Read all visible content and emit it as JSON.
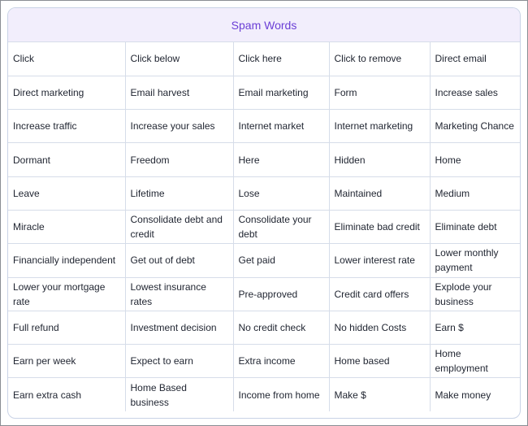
{
  "title": "Spam Words",
  "rows": [
    [
      "Click",
      "Click below",
      "Click here",
      "Click to remove",
      "Direct email"
    ],
    [
      "Direct marketing",
      "Email harvest",
      "Email marketing",
      "Form",
      "Increase sales"
    ],
    [
      "Increase traffic",
      "Increase your sales",
      "Internet market",
      "Internet marketing",
      "Marketing Chance"
    ],
    [
      "Dormant",
      "Freedom",
      "Here",
      "Hidden",
      "Home"
    ],
    [
      "Leave",
      "Lifetime",
      "Lose",
      "Maintained",
      "Medium"
    ],
    [
      "Miracle",
      "Consolidate debt and credit",
      "Consolidate your debt",
      "Eliminate bad credit",
      "Eliminate debt"
    ],
    [
      "Financially independent",
      "Get out of debt",
      "Get paid",
      "Lower interest rate",
      "Lower monthly payment"
    ],
    [
      "Lower your mortgage rate",
      "Lowest insurance rates",
      "Pre-approved",
      "Credit card offers",
      "Explode your business"
    ],
    [
      "Full refund",
      "Investment decision",
      "No credit check",
      "No hidden Costs",
      "Earn $"
    ],
    [
      "Earn per week",
      "Expect to earn",
      "Extra income",
      "Home based",
      "Home employment"
    ],
    [
      "Earn extra cash",
      "Home Based business",
      "Income from home",
      "Make $",
      "Make money"
    ]
  ]
}
